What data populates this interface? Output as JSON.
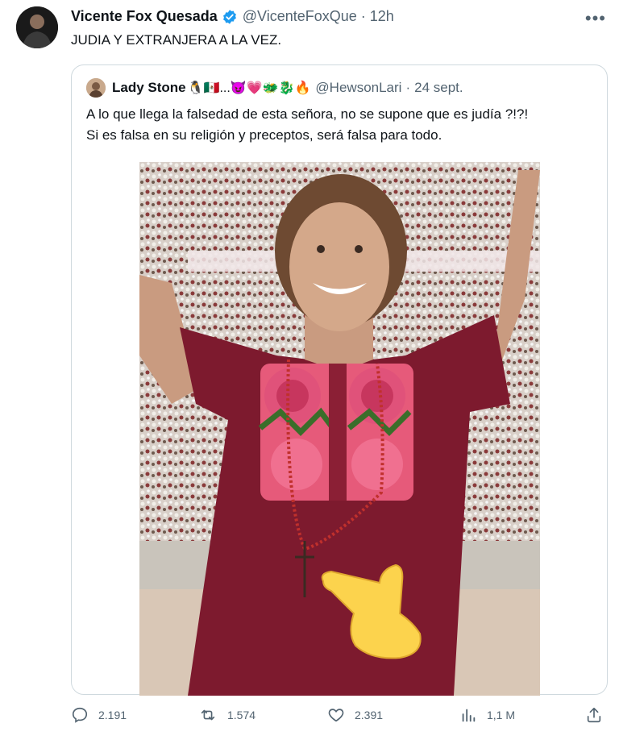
{
  "tweet": {
    "author_name": "Vicente Fox Quesada",
    "author_handle": "@VicenteFoxQue",
    "separator": "·",
    "time": "12h",
    "more_label": "•••",
    "text": "JUDIA Y EXTRANJERA A LA VEZ.",
    "verified": true
  },
  "quote": {
    "author_name": "Lady Stone",
    "author_emojis": "🐧🇲🇽...😈💗🐲🐉🔥",
    "author_handle": "@HewsonLari",
    "separator": "·",
    "date": "24 sept.",
    "text_line1": "A lo que llega la falsedad de esta señora, no se supone que es judía ?!?!",
    "text_line2": "Si es falsa en su religión y preceptos, será falsa para todo.",
    "image": {
      "description_icon": "woman-in-maroon-embroidered-blouse-pointing-hand-emoji"
    }
  },
  "actions": {
    "replies": "2.191",
    "retweets": "1.574",
    "likes": "2.391",
    "views": "1,1 M"
  },
  "colors": {
    "verified_blue": "#1d9bf0",
    "secondary_text": "#536471",
    "border": "#cfd9de"
  }
}
